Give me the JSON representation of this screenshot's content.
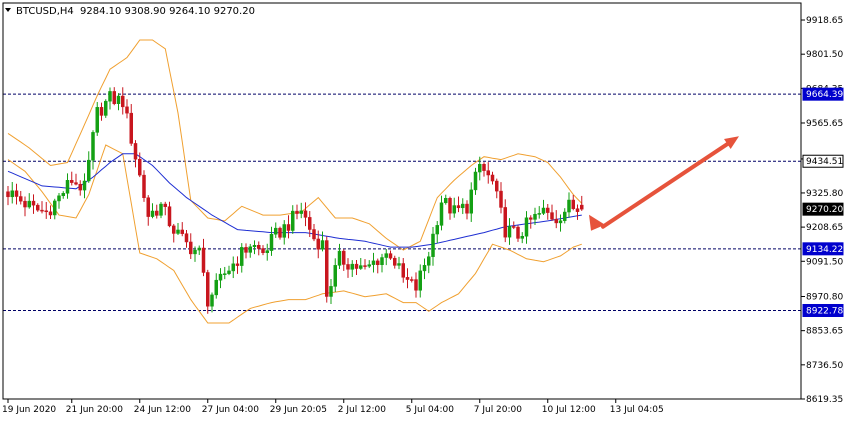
{
  "header": {
    "symbol_label": "BTCUSD,H4",
    "ohlc_text": "9284.10 9308.90 9264.10 9270.20"
  },
  "chart_data": {
    "type": "candlestick",
    "symbol": "BTCUSD",
    "timeframe": "H4",
    "ohlc": {
      "open": 9284.1,
      "high": 9308.9,
      "low": 9264.1,
      "close": 9270.2
    },
    "ylim": [
      8619.35,
      9977.0
    ],
    "y_ticks": [
      9918.65,
      9801.5,
      9684.35,
      9565.65,
      9442.35,
      9325.8,
      9208.65,
      9091.5,
      8970.8,
      8853.65,
      8736.5,
      8619.35
    ],
    "x_ticks": [
      "19 Jun 2020",
      "21 Jun 20:00",
      "24 Jun 12:00",
      "27 Jun 04:00",
      "29 Jun 20:05",
      "2 Jul 12:00",
      "5 Jul 04:00",
      "7 Jul 20:00",
      "10 Jul 12:00",
      "13 Jul 04:05"
    ],
    "x_ticks_index": [
      0,
      15,
      31,
      47,
      63,
      79,
      95,
      111,
      127,
      143
    ],
    "levels": [
      {
        "value": 9664.39,
        "label": "9664.39",
        "style": "dashed",
        "label_bg": "#0000cd"
      },
      {
        "value": 9434.51,
        "label": "9434.51",
        "style": "dashed",
        "label_bg": "#ffffff"
      },
      {
        "value": 9134.22,
        "label": "9134.22",
        "style": "dashed",
        "label_bg": "#0000cd"
      },
      {
        "value": 8922.78,
        "label": "8922.78",
        "style": "dashed",
        "label_bg": "#0000cd"
      }
    ],
    "current_price": {
      "value": 9270.2,
      "label": "9270.20"
    },
    "anchors": {
      "close": [
        [
          0,
          9330
        ],
        [
          3,
          9300
        ],
        [
          6,
          9270
        ],
        [
          9,
          9260
        ],
        [
          12,
          9310
        ],
        [
          15,
          9370
        ],
        [
          18,
          9340
        ],
        [
          21,
          9600
        ],
        [
          24,
          9650
        ],
        [
          27,
          9640
        ],
        [
          30,
          9450
        ],
        [
          33,
          9250
        ],
        [
          36,
          9280
        ],
        [
          39,
          9200
        ],
        [
          42,
          9150
        ],
        [
          45,
          9120
        ],
        [
          47,
          8960
        ],
        [
          49,
          9000
        ],
        [
          51,
          9050
        ],
        [
          54,
          9100
        ],
        [
          57,
          9150
        ],
        [
          60,
          9120
        ],
        [
          63,
          9180
        ],
        [
          66,
          9220
        ],
        [
          69,
          9270
        ],
        [
          72,
          9170
        ],
        [
          74,
          9150
        ],
        [
          75,
          8980
        ],
        [
          78,
          9100
        ],
        [
          81,
          9080
        ],
        [
          84,
          9060
        ],
        [
          87,
          9100
        ],
        [
          90,
          9120
        ],
        [
          93,
          9030
        ],
        [
          96,
          9000
        ],
        [
          99,
          9120
        ],
        [
          102,
          9300
        ],
        [
          105,
          9260
        ],
        [
          108,
          9280
        ],
        [
          111,
          9420
        ],
        [
          114,
          9360
        ],
        [
          117,
          9200
        ],
        [
          120,
          9180
        ],
        [
          123,
          9230
        ],
        [
          126,
          9260
        ],
        [
          129,
          9240
        ],
        [
          132,
          9280
        ],
        [
          135,
          9270
        ]
      ],
      "upper_band": [
        [
          0,
          9530
        ],
        [
          5,
          9480
        ],
        [
          10,
          9420
        ],
        [
          14,
          9430
        ],
        [
          18,
          9560
        ],
        [
          21,
          9660
        ],
        [
          24,
          9750
        ],
        [
          28,
          9790
        ],
        [
          31,
          9850
        ],
        [
          34,
          9850
        ],
        [
          37,
          9820
        ],
        [
          40,
          9600
        ],
        [
          43,
          9300
        ],
        [
          47,
          9240
        ],
        [
          51,
          9230
        ],
        [
          55,
          9280
        ],
        [
          60,
          9250
        ],
        [
          64,
          9250
        ],
        [
          69,
          9260
        ],
        [
          73,
          9310
        ],
        [
          77,
          9240
        ],
        [
          81,
          9240
        ],
        [
          85,
          9220
        ],
        [
          89,
          9170
        ],
        [
          93,
          9130
        ],
        [
          97,
          9160
        ],
        [
          101,
          9310
        ],
        [
          105,
          9370
        ],
        [
          109,
          9420
        ],
        [
          112,
          9450
        ],
        [
          116,
          9440
        ],
        [
          120,
          9460
        ],
        [
          124,
          9450
        ],
        [
          127,
          9430
        ],
        [
          130,
          9380
        ],
        [
          133,
          9320
        ],
        [
          135,
          9290
        ]
      ],
      "lower_band": [
        [
          0,
          9440
        ],
        [
          4,
          9400
        ],
        [
          8,
          9330
        ],
        [
          12,
          9250
        ],
        [
          16,
          9240
        ],
        [
          19,
          9320
        ],
        [
          23,
          9490
        ],
        [
          27,
          9460
        ],
        [
          31,
          9120
        ],
        [
          35,
          9100
        ],
        [
          39,
          9060
        ],
        [
          43,
          8960
        ],
        [
          47,
          8880
        ],
        [
          52,
          8880
        ],
        [
          57,
          8930
        ],
        [
          62,
          8950
        ],
        [
          66,
          8960
        ],
        [
          70,
          8960
        ],
        [
          74,
          8980
        ],
        [
          79,
          8990
        ],
        [
          84,
          8970
        ],
        [
          89,
          8980
        ],
        [
          93,
          8950
        ],
        [
          96,
          8950
        ],
        [
          99,
          8920
        ],
        [
          102,
          8950
        ],
        [
          106,
          8980
        ],
        [
          110,
          9050
        ],
        [
          114,
          9150
        ],
        [
          118,
          9130
        ],
        [
          122,
          9100
        ],
        [
          126,
          9090
        ],
        [
          130,
          9110
        ],
        [
          133,
          9140
        ],
        [
          135,
          9150
        ]
      ],
      "ma": [
        [
          0,
          9400
        ],
        [
          8,
          9350
        ],
        [
          16,
          9340
        ],
        [
          20,
          9380
        ],
        [
          24,
          9430
        ],
        [
          27,
          9460
        ],
        [
          30,
          9460
        ],
        [
          34,
          9420
        ],
        [
          38,
          9360
        ],
        [
          42,
          9310
        ],
        [
          48,
          9250
        ],
        [
          54,
          9200
        ],
        [
          62,
          9190
        ],
        [
          70,
          9190
        ],
        [
          78,
          9170
        ],
        [
          84,
          9160
        ],
        [
          90,
          9140
        ],
        [
          95,
          9140
        ],
        [
          100,
          9150
        ],
        [
          106,
          9170
        ],
        [
          112,
          9190
        ],
        [
          117,
          9210
        ],
        [
          122,
          9220
        ],
        [
          127,
          9230
        ],
        [
          131,
          9240
        ],
        [
          135,
          9250
        ]
      ]
    },
    "n_candles": 136,
    "arrow": {
      "from": [
        140,
        9210
      ],
      "to": [
        172,
        9520
      ],
      "color": "#e6533b"
    },
    "colors": {
      "bull": "#14a014",
      "bear": "#c8161e",
      "band": "#f0a030",
      "ma": "#1e2ed2",
      "dashed_line": "#000066",
      "grid_line": "#000000"
    }
  }
}
